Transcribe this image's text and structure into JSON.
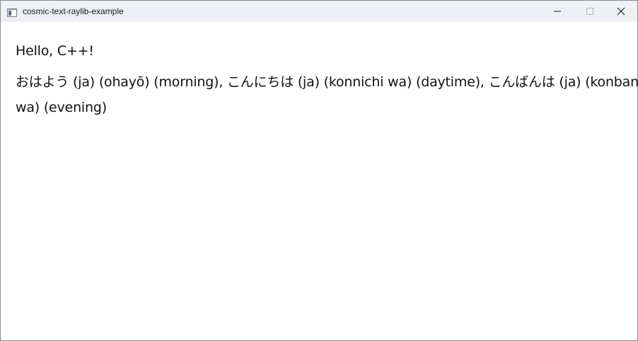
{
  "window": {
    "title": "cosmic-text-raylib-example"
  },
  "titlebar": {
    "icons": {
      "app": "app-window-icon",
      "minimize": "minimize-icon",
      "maximize": "maximize-icon",
      "close": "close-icon"
    }
  },
  "content": {
    "lines": [
      "Hello, C++!",
      "おはよう (ja) (ohayō) (morning), こんにちは (ja) (konnichi wa) (daytime), こんばんは (ja) (konban",
      "wa) (evening)"
    ]
  },
  "colors": {
    "titlebar_bg": "#eef0f5",
    "content_bg": "#ffffff",
    "text": "#111111"
  }
}
